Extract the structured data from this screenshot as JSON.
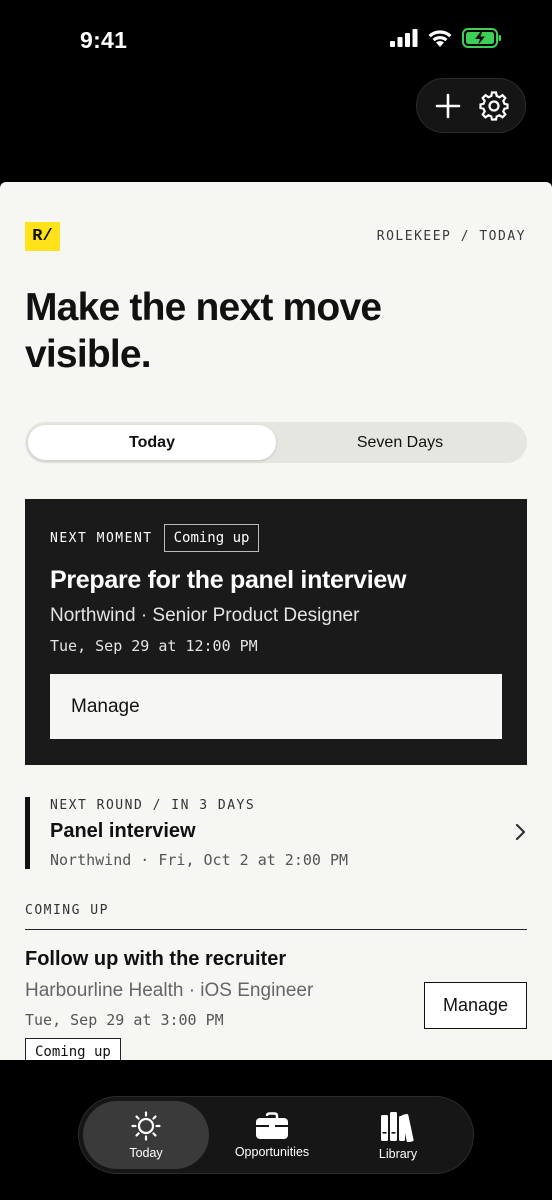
{
  "status_bar": {
    "time": "9:41"
  },
  "top_actions": {
    "add_icon": "plus-icon",
    "settings_icon": "gear-icon"
  },
  "brand": {
    "logo_text": "R/",
    "breadcrumb": "ROLEKEEP / TODAY",
    "accent": "#ffe21a"
  },
  "headline": "Make the next move visible.",
  "segments": [
    {
      "label": "Today",
      "active": true
    },
    {
      "label": "Seven Days",
      "active": false
    }
  ],
  "hero": {
    "label": "NEXT MOMENT",
    "tag": "Coming up",
    "title": "Prepare for the panel interview",
    "subtitle": "Northwind · Senior Product Designer",
    "when": "Tue, Sep 29 at 12:00 PM",
    "action": "Manage"
  },
  "next_round": {
    "label": "NEXT ROUND / IN 3 DAYS",
    "title": "Panel interview",
    "meta": "Northwind · Fri, Oct 2 at 2:00 PM"
  },
  "coming_up": {
    "label": "COMING UP",
    "items": [
      {
        "title": "Follow up with the recruiter",
        "subtitle": "Harbourline Health · iOS Engineer",
        "when": "Tue, Sep 29 at 3:00 PM",
        "tag": "Coming up",
        "action": "Manage"
      }
    ]
  },
  "tabs": [
    {
      "label": "Today",
      "icon": "sun-icon",
      "active": true
    },
    {
      "label": "Opportunities",
      "icon": "briefcase-icon",
      "active": false
    },
    {
      "label": "Library",
      "icon": "books-icon",
      "active": false
    }
  ]
}
